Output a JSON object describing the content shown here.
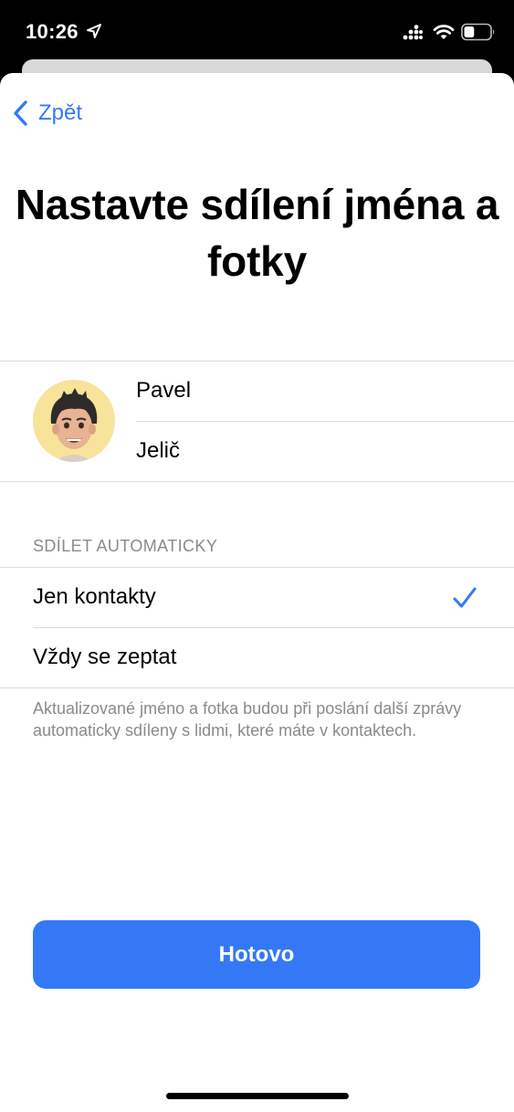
{
  "status_bar": {
    "time": "10:26",
    "icons": [
      "location-arrow-icon",
      "signal-icon",
      "wifi-icon",
      "battery-icon"
    ],
    "battery_level": 0.4
  },
  "nav": {
    "back_label": "Zpět",
    "back_icon": "chevron-left-icon"
  },
  "title": "Nastavte sdílení jména a fotky",
  "profile": {
    "avatar_icon": "memoji-avatar",
    "first_name": "Pavel",
    "last_name": "Jelič"
  },
  "share_section": {
    "header": "SDÍLET AUTOMATICKY",
    "options": [
      {
        "label": "Jen kontakty",
        "selected": true
      },
      {
        "label": "Vždy se zeptat",
        "selected": false
      }
    ],
    "footer": "Aktualizované jméno a fotka budou při poslání další zprávy automaticky sdíleny s lidmi, které máte v kontaktech."
  },
  "done_button": {
    "label": "Hotovo"
  },
  "colors": {
    "accent": "#3478f6",
    "secondary_text": "#8a8a8e",
    "separator": "#dcdcdf",
    "avatar_background": "#f8e39b"
  }
}
